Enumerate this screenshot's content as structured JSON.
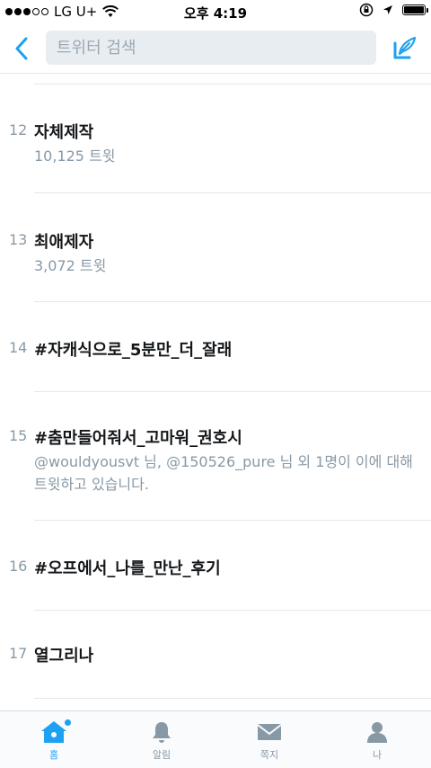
{
  "status_bar": {
    "carrier": "LG U+",
    "time": "오후 4:19"
  },
  "header": {
    "search_placeholder": "트위터 검색",
    "back_icon": "chevron-left-icon",
    "compose_icon": "compose-tweet-icon",
    "accent_color": "#1da1f2"
  },
  "trends": [
    {
      "rank": "12",
      "title": "자체제작",
      "sub": "10,125 트윗"
    },
    {
      "rank": "13",
      "title": "최애제자",
      "sub": "3,072 트윗"
    },
    {
      "rank": "14",
      "title": "#자캐식으로_5분만_더_잘래",
      "sub": ""
    },
    {
      "rank": "15",
      "title": "#춤만들어줘서_고마워_권호시",
      "sub": "@wouldyousvt 님, @150526_pure 님 외 1명이 이에 대해 트윗하고 있습니다."
    },
    {
      "rank": "16",
      "title": "#오프에서_나를_만난_후기",
      "sub": ""
    },
    {
      "rank": "17",
      "title": "열그리나",
      "sub": ""
    }
  ],
  "tabs": [
    {
      "label": "홈",
      "icon": "home-icon",
      "active": true
    },
    {
      "label": "알림",
      "icon": "bell-icon",
      "active": false
    },
    {
      "label": "쪽지",
      "icon": "envelope-icon",
      "active": false
    },
    {
      "label": "나",
      "icon": "person-icon",
      "active": false
    }
  ]
}
